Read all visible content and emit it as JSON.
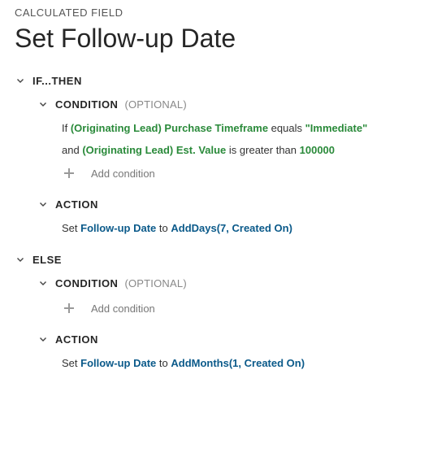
{
  "breadcrumb": "CALCULATED FIELD",
  "title": "Set Follow-up Date",
  "labels": {
    "if_then": "IF...THEN",
    "else": "ELSE",
    "condition": "CONDITION",
    "action": "ACTION",
    "optional": "(OPTIONAL)",
    "add_condition": "Add condition"
  },
  "if_block": {
    "conditions": [
      {
        "prefix": "If ",
        "field": "(Originating Lead) Purchase Timeframe",
        "operator": " equals ",
        "value": "\"Immediate\""
      },
      {
        "prefix": "and ",
        "field": "(Originating Lead) Est. Value",
        "operator": " is greater than ",
        "value": "100000"
      }
    ],
    "action": {
      "prefix": "Set ",
      "field": "Follow-up Date",
      "mid": " to ",
      "func": "AddDays(7, Created On)"
    }
  },
  "else_block": {
    "action": {
      "prefix": "Set ",
      "field": "Follow-up Date",
      "mid": " to ",
      "func": "AddMonths(1, Created On)"
    }
  }
}
